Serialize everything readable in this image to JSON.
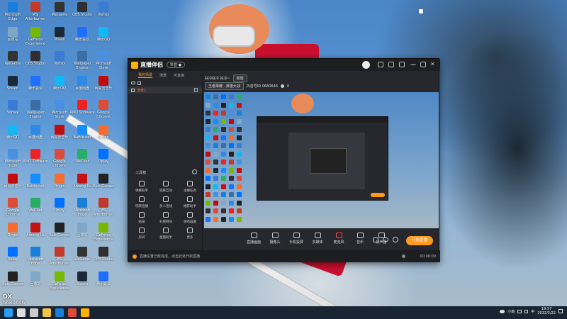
{
  "desktop": {
    "icons": [
      {
        "label": "Microsoft Edge",
        "color": "#1a7fd9"
      },
      {
        "label": "回收站",
        "color": "#7fa8c8"
      },
      {
        "label": "WeGame",
        "color": "#333"
      },
      {
        "label": "Steam",
        "color": "#1b2838"
      },
      {
        "label": "Vortex",
        "color": "#3a7bd5"
      },
      {
        "label": "腾讯QQ",
        "color": "#12b7f5"
      },
      {
        "label": "Microsoft Store",
        "color": "#4a90e2"
      },
      {
        "label": "网易云音乐",
        "color": "#c20c0c"
      },
      {
        "label": "Google Chrome",
        "color": "#dd4b39"
      },
      {
        "label": "Origin",
        "color": "#f56c2d"
      },
      {
        "label": "Uplay",
        "color": "#0070ff"
      },
      {
        "label": "Epic Games",
        "color": "#222"
      },
      {
        "label": "MSI Afterburner",
        "color": "#c0392b"
      },
      {
        "label": "GeForce Experience",
        "color": "#76b900"
      },
      {
        "label": "OBS Studio",
        "color": "#302e31"
      },
      {
        "label": "腾讯会议",
        "color": "#1e6fff"
      },
      {
        "label": "Wallpaper Engine",
        "color": "#3a6ea5"
      },
      {
        "label": "百度网盘",
        "color": "#2e8ae6"
      },
      {
        "label": "AMD Software",
        "color": "#e22"
      },
      {
        "label": "Battle.net",
        "color": "#148eff"
      },
      {
        "label": "WeChat",
        "color": "#2aae67"
      },
      {
        "label": "Among Us",
        "color": "#c51111"
      }
    ],
    "side_panel": {
      "label": "DX"
    }
  },
  "app": {
    "name": "直播伴侣",
    "version_badge": "抖音 ●",
    "tabs": [
      "我的场景",
      "场景",
      "可直接"
    ],
    "scene_row": {
      "label": "场景1"
    },
    "tools_title": "工具箱",
    "tools": [
      "弹幕助手",
      "观看互动",
      "主播任务",
      "玩转直播",
      "多人连线",
      "推荐助手",
      "贴纸",
      "礼物特效",
      "游戏画面",
      "房间",
      "直播助手",
      "更多"
    ],
    "stream_title": "好冷好冷 好冷~",
    "stream_tag": "新建",
    "category": "王者荣耀 · 英雄大战",
    "room_id": "抖音号ID  0680646",
    "fans": "0",
    "controls": [
      "直播画面",
      "摄像头",
      "手机投屏",
      "多媒体",
      "麦克风",
      "音乐",
      "扬声器"
    ],
    "start_button": "开始直播",
    "status_text": "直播设置已经完成，点击此处开启直播",
    "timer": "00:00:00"
  },
  "overlay": {
    "line1": "DX",
    "line2": "6680646"
  },
  "taskbar": {
    "time": "19:57",
    "date": "2022/2/22",
    "weather": "小雨",
    "ime": "中",
    "apps": [
      {
        "name": "start-icon",
        "color": "#2a9df4"
      },
      {
        "name": "search-icon",
        "color": "#ddd"
      },
      {
        "name": "taskview-icon",
        "color": "#ccc"
      },
      {
        "name": "explorer-icon",
        "color": "#f4c542"
      },
      {
        "name": "edge-icon",
        "color": "#1a7fd9"
      },
      {
        "name": "chrome-icon",
        "color": "#dd4b39"
      },
      {
        "name": "live-companion-icon",
        "color": "#ffb300"
      }
    ]
  }
}
